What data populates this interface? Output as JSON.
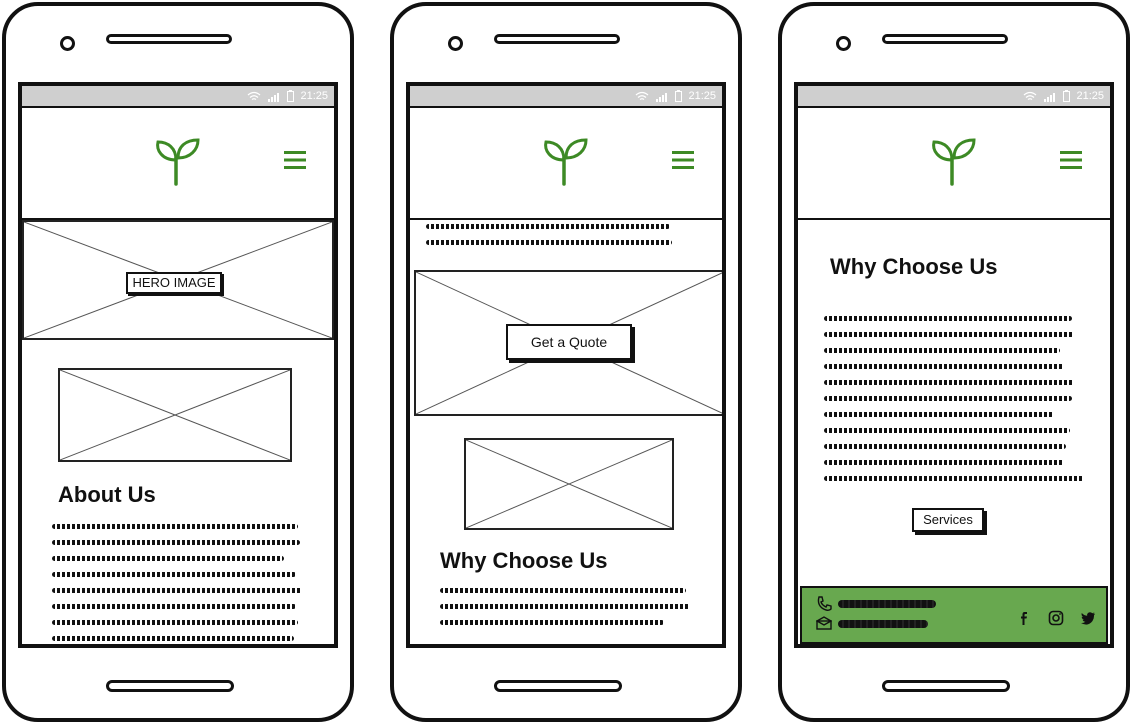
{
  "status_bar": {
    "time": "21:25"
  },
  "phone1": {
    "hero_label": "HERO IMAGE",
    "heading": "About Us"
  },
  "phone2": {
    "cta_label": "Get a Quote",
    "heading": "Why Choose Us"
  },
  "phone3": {
    "heading": "Why Choose Us",
    "services_label": "Services",
    "footer": {
      "phone_icon": "phone-icon",
      "email_icon": "envelope-icon",
      "social": [
        "facebook-icon",
        "instagram-icon",
        "twitter-icon"
      ]
    }
  },
  "colors": {
    "accent": "#3d8a25",
    "footer_green": "#68a84f"
  }
}
